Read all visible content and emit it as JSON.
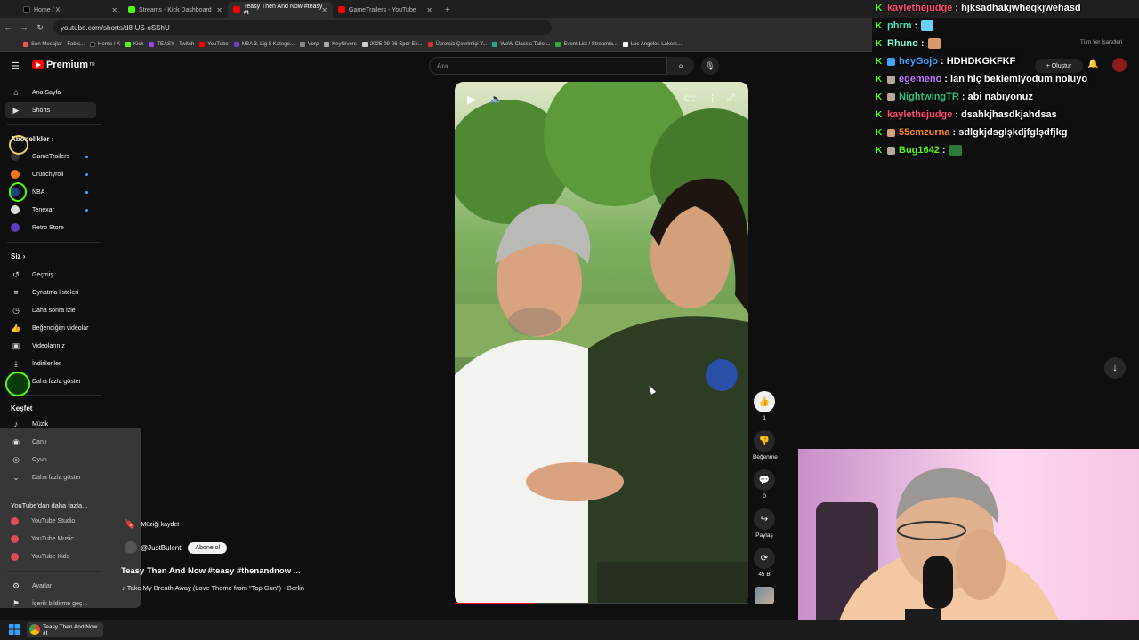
{
  "browser": {
    "tabs": [
      {
        "label": "Home / X",
        "color": "#000000"
      },
      {
        "label": "Streams - Kick Dashboard",
        "color": "#53fc18"
      },
      {
        "label": "Teasy Then And Now #teasy #t",
        "color": "#ff0000"
      },
      {
        "label": "GameTrailers - YouTube",
        "color": "#ff0000"
      }
    ],
    "url": "youtube.com/shorts/d8-US-oSShU",
    "bookmarks": [
      "Son Mesajlar - Fabic...",
      "Home / X",
      "Kick",
      "TEASY - Twitch",
      "YouTube",
      "NBA 3. Lig 8 Katego...",
      "Vorp",
      "KeyGivers",
      "2025-09-06 Spor Ek...",
      "Ücretsiz Çevrimiçi Y...",
      "WoW Classic Tailor...",
      "Event List / Streamla...",
      "Los Angeles Lakers..."
    ],
    "all_bookmarks": "Tüm Yer İşaretleri"
  },
  "youtube": {
    "logo_text": "Premium",
    "logo_sup": "TR",
    "search_placeholder": "Ara",
    "create_label": "+ Oluştur",
    "sidebar": {
      "home": "Ana Sayfa",
      "shorts": "Shorts",
      "subscriptions_head": "Abonelikler",
      "subscriptions": [
        {
          "label": "GameTrailers",
          "color": "#333333"
        },
        {
          "label": "Crunchyroll",
          "color": "#f47521"
        },
        {
          "label": "NBA",
          "color": "#1d428a"
        },
        {
          "label": "Tenexar",
          "color": "#dddddd"
        },
        {
          "label": "Retro Store",
          "color": "#5a3fbf"
        }
      ],
      "you_head": "Siz",
      "you_items": [
        "Geçmiş",
        "Oynatma listeleri",
        "Daha sonra izle",
        "Beğendiğim videolar",
        "Videolarınız",
        "İndirilenler",
        "Daha fazla göster"
      ],
      "explore_head": "Keşfet",
      "explore_items": [
        "Müzik",
        "Canlı",
        "Oyun",
        "Daha fazla göster"
      ],
      "more_head": "YouTube'dan daha fazla...",
      "more_items": [
        "YouTube Studio",
        "YouTube Music",
        "YouTube Kids"
      ],
      "settings": "Ayarlar",
      "report": "İçerik bildirme geç..."
    },
    "short": {
      "save_music": "Müziği kaydet",
      "channel": "@JustBulent",
      "subscribe": "Abone ol",
      "title": "Teasy Then And Now #teasy #thenandnow ...",
      "music": "♪ Take My Breath Away (Love Theme from \"Top Gun\") · Berlin",
      "progress": 0.27,
      "actions": {
        "likes": "1",
        "dislike": "Beğenme",
        "comments": "0",
        "share": "Paylaş",
        "remix": "45 B"
      }
    }
  },
  "chat": [
    {
      "user": "kaylethejudge",
      "color": "#ff4d6d",
      "msg": ": hjksadhakjwheqkjwehasd",
      "badge": ""
    },
    {
      "user": "phrm",
      "color": "#4fe3c1",
      "msg": ":",
      "badge": "",
      "emote": "#6ad0ff"
    },
    {
      "user": "Rhuno",
      "color": "#7fffd4",
      "msg": ":",
      "badge": "",
      "emote": "#d89a6a"
    },
    {
      "user": "heyGojo",
      "color": "#3ea6ff",
      "msg": ": HDHDKGKFKF",
      "badge": "#3ea6ff"
    },
    {
      "user": "egemeno",
      "color": "#c27bff",
      "msg": ": lan hiç beklemiyodum noluyo",
      "badge": "#b7a99a"
    },
    {
      "user": "NightwingTR",
      "color": "#2ec27e",
      "msg": ": abi nabıyonuz",
      "badge": "#b7a99a"
    },
    {
      "user": "kaylethejudge",
      "color": "#ff4d6d",
      "msg": ": dsahkjhasdkjahdsas",
      "badge": ""
    },
    {
      "user": "55cmzurna",
      "color": "#ff8c1a",
      "msg": ": sdlgkjdsglşkdjfglşdfjkg",
      "badge": "#d4a373"
    },
    {
      "user": "Bug1642",
      "color": "#53fc18",
      "msg": ":",
      "badge": "#b7a99a",
      "emote": "#2f7a3a"
    }
  ],
  "taskbar": {
    "app_label": "Teasy Then And Now #t"
  }
}
